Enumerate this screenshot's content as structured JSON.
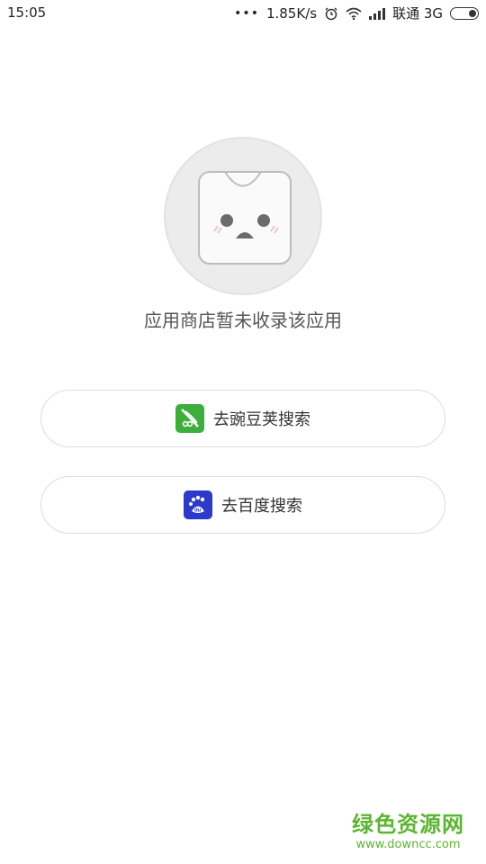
{
  "status_bar": {
    "time": "15:05",
    "dots": "•••",
    "speed": "1.85K/s",
    "carrier": "联通 3G"
  },
  "empty_state": {
    "message": "应用商店暂未收录该应用"
  },
  "actions": [
    {
      "label": "去豌豆荚搜索",
      "icon": "wandoujia-icon",
      "color": "#3cae3a"
    },
    {
      "label": "去百度搜索",
      "icon": "baidu-icon",
      "color": "#2c39c9"
    }
  ],
  "watermark": {
    "title": "绿色资源网",
    "url": "www.downcc.com"
  }
}
